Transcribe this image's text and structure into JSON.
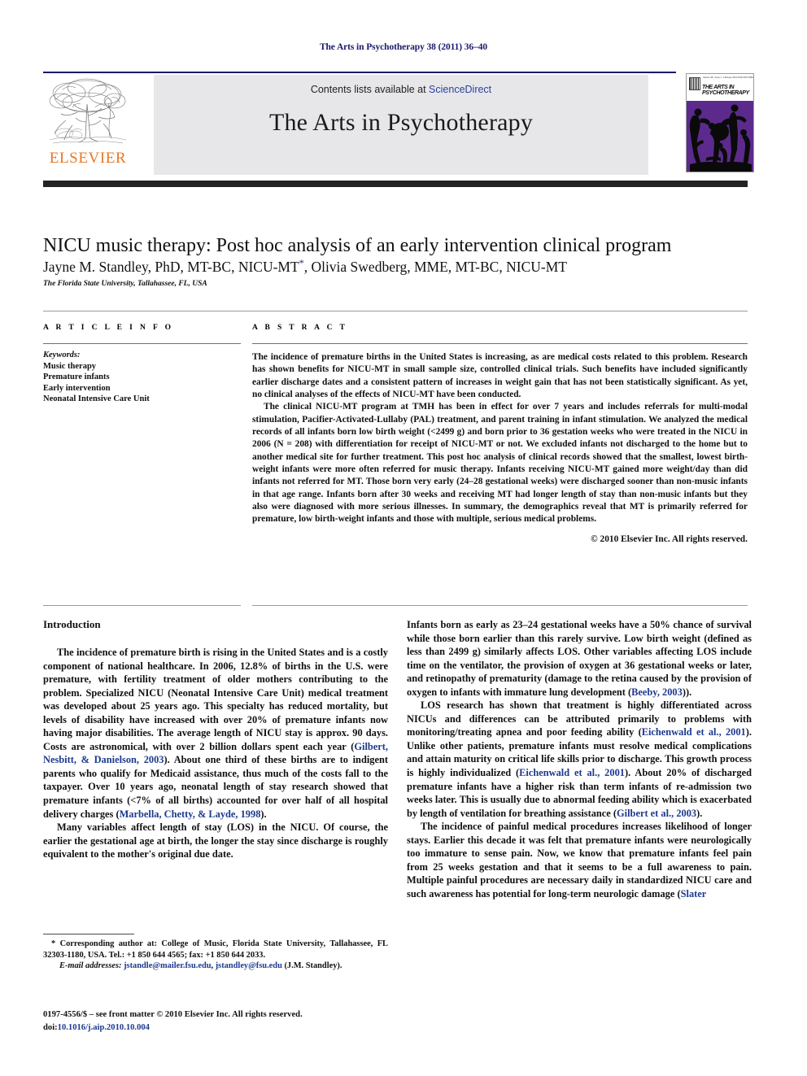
{
  "running_head": "The Arts in Psychotherapy 38 (2011) 36–40",
  "masthead": {
    "publisher_name": "ELSEVIER",
    "contents_prefix": "Contents lists available at ",
    "sciencedirect": "ScienceDirect",
    "journal_title": "The Arts in Psychotherapy",
    "cover": {
      "header_line": "Volume 38 · Issue 1 · February 2011          ISSN 0197-4556",
      "journal_name": "THE ARTS IN PSYCHOTHERAPY",
      "art_color": "#5c2a8c"
    },
    "accent_orange": "#E87722",
    "link_blue": "#2b3f9e",
    "rule_navy": "#1a1a6e"
  },
  "article": {
    "title": "NICU music therapy: Post hoc analysis of an early intervention clinical program",
    "authors": "Jayne M. Standley, PhD, MT-BC, NICU-MT",
    "author_marker": "*",
    "authors_rest": ", Olivia Swedberg, MME, MT-BC, NICU-MT",
    "affiliation": "The Florida State University, Tallahassee, FL, USA"
  },
  "article_info": {
    "heading": "A R T I C L E   I N F O",
    "keywords_label": "Keywords:",
    "keywords": [
      "Music therapy",
      "Premature infants",
      "Early intervention",
      "Neonatal Intensive Care Unit"
    ]
  },
  "abstract": {
    "heading": "A B S T R A C T",
    "paragraphs": [
      "The incidence of premature births in the United States is increasing, as are medical costs related to this problem. Research has shown benefits for NICU-MT in small sample size, controlled clinical trials. Such benefits have included significantly earlier discharge dates and a consistent pattern of increases in weight gain that has not been statistically significant. As yet, no clinical analyses of the effects of NICU-MT have been conducted.",
      "The clinical NICU-MT program at TMH has been in effect for over 7 years and includes referrals for multi-modal stimulation, Pacifier-Activated-Lullaby (PAL) treatment, and parent training in infant stimulation. We analyzed the medical records of all infants born low birth weight (<2499 g) and born prior to 36 gestation weeks who were treated in the NICU in 2006 (N = 208) with differentiation for receipt of NICU-MT or not. We excluded infants not discharged to the home but to another medical site for further treatment. This post hoc analysis of clinical records showed that the smallest, lowest birth-weight infants were more often referred for music therapy. Infants receiving NICU-MT gained more weight/day than did infants not referred for MT. Those born very early (24–28 gestational weeks) were discharged sooner than non-music infants in that age range. Infants born after 30 weeks and receiving MT had longer length of stay than non-music infants but they also were diagnosed with more serious illnesses. In summary, the demographics reveal that MT is primarily referred for premature, low birth-weight infants and those with multiple, serious medical problems."
    ],
    "copyright": "© 2010 Elsevier Inc. All rights reserved."
  },
  "body": {
    "intro_heading": "Introduction",
    "left_paragraphs": [
      "The incidence of premature birth is rising in the United States and is a costly component of national healthcare. In 2006, 12.8% of births in the U.S. were premature, with fertility treatment of older mothers contributing to the problem. Specialized NICU (Neonatal Intensive Care Unit) medical treatment was developed about 25 years ago. This specialty has reduced mortality, but levels of disability have increased with over 20% of premature infants now having major disabilities. The average length of NICU stay is approx. 90 days. Costs are astronomical, with over 2 billion dollars spent each year (Gilbert, Nesbitt, & Danielson, 2003). About one third of these births are to indigent parents who qualify for Medicaid assistance, thus much of the costs fall to the taxpayer. Over 10 years ago, neonatal length of stay research showed that premature infants (<7% of all births) accounted for over half of all hospital delivery charges (Marbella, Chetty, & Layde, 1998).",
      "Many variables affect length of stay (LOS) in the NICU. Of course, the earlier the gestational age at birth, the longer the stay since discharge is roughly equivalent to the mother's original due date."
    ],
    "right_paragraphs": [
      "Infants born as early as 23–24 gestational weeks have a 50% chance of survival while those born earlier than this rarely survive. Low birth weight (defined as less than 2499 g) similarly affects LOS. Other variables affecting LOS include time on the ventilator, the provision of oxygen at 36 gestational weeks or later, and retinopathy of prematurity (damage to the retina caused by the provision of oxygen to infants with immature lung development (Beeby, 2003)).",
      "LOS research has shown that treatment is highly differentiated across NICUs and differences can be attributed primarily to problems with monitoring/treating apnea and poor feeding ability (Eichenwald et al., 2001). Unlike other patients, premature infants must resolve medical complications and attain maturity on critical life skills prior to discharge. This growth process is highly individualized (Eichenwald et al., 2001). About 20% of discharged premature infants have a higher risk than term infants of re-admission two weeks later. This is usually due to abnormal feeding ability which is exacerbated by length of ventilation for breathing assistance (Gilbert et al., 2003).",
      "The incidence of painful medical procedures increases likelihood of longer stays. Earlier this decade it was felt that premature infants were neurologically too immature to sense pain. Now, we know that premature infants feel pain from 25 weeks gestation and that it seems to be a full awareness to pain. Multiple painful procedures are necessary daily in standardized NICU care and such awareness has potential for long-term neurologic damage (Slater"
    ],
    "citations_left": [
      "Gilbert, Nesbitt, & Danielson, 2003",
      "Marbella, Chetty, & Layde, 1998"
    ],
    "citations_right": [
      "Beeby, 2003",
      "Eichenwald et al., 2001",
      "Gilbert et al., 2003",
      "Slater"
    ]
  },
  "footnotes": {
    "corresponding_marker": "*",
    "corresponding": " Corresponding author at: College of Music, Florida State University, Tallahassee, FL 32303-1180, USA. Tel.: +1 850 644 4565; fax: +1 850 644 2033.",
    "email_label": "E-mail addresses:",
    "email1": "jstandle@mailer.fsu.edu",
    "email2": "jstandley@fsu.edu",
    "email_attribution": "(J.M. Standley).",
    "issn_line": "0197-4556/$ – see front matter © 2010 Elsevier Inc. All rights reserved.",
    "doi_label": "doi:",
    "doi_value": "10.1016/j.aip.2010.10.004"
  }
}
